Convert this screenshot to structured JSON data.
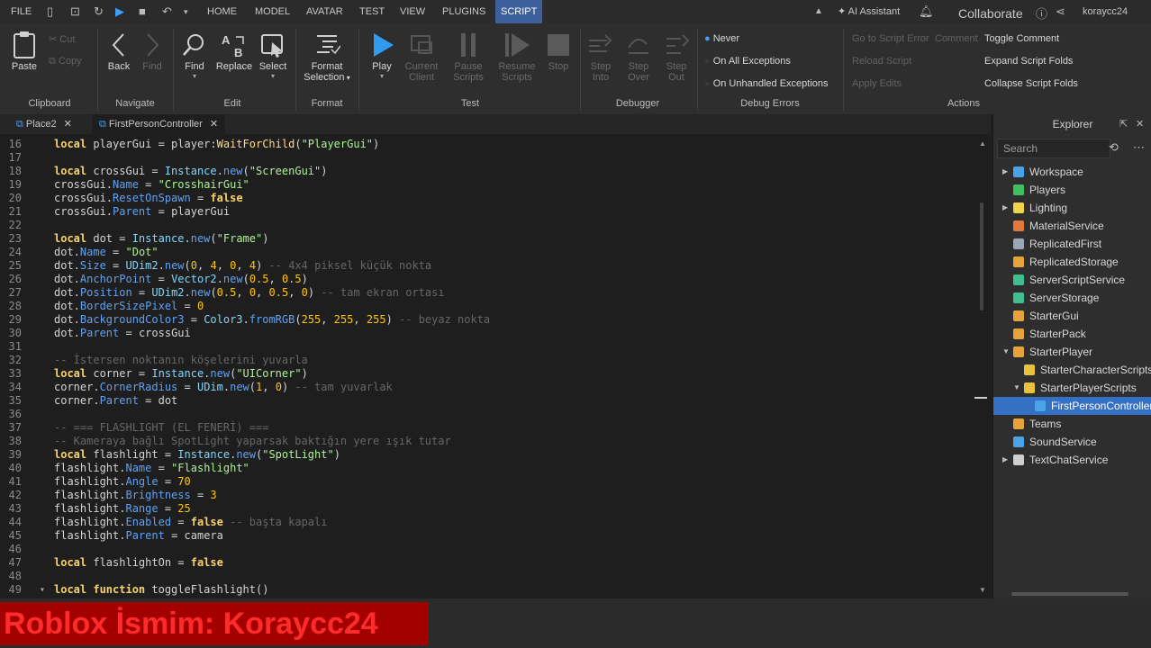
{
  "menubar": {
    "file": "FILE",
    "tabs": [
      "HOME",
      "MODEL",
      "AVATAR",
      "TEST",
      "VIEW",
      "PLUGINS",
      "SCRIPT"
    ],
    "active_tab": "SCRIPT",
    "ai_assistant": "AI Assistant",
    "collaborate": "Collaborate",
    "username": "koraycc24"
  },
  "ribbon": {
    "clipboard": {
      "paste": "Paste",
      "cut": "Cut",
      "copy": "Copy",
      "group": "Clipboard"
    },
    "navigate": {
      "back": "Back",
      "find": "Find",
      "group": "Navigate"
    },
    "edit": {
      "find": "Find",
      "replace": "Replace",
      "select": "Select",
      "group": "Edit"
    },
    "format": {
      "format_selection_1": "Format",
      "format_selection_2": "Selection",
      "group": "Format"
    },
    "test": {
      "play": "Play",
      "current_1": "Current",
      "current_2": "Client",
      "pause_1": "Pause",
      "pause_2": "Scripts",
      "resume_1": "Resume",
      "resume_2": "Scripts",
      "stop": "Stop",
      "group": "Test"
    },
    "debugger": {
      "step_into_1": "Step",
      "step_into_2": "Into",
      "step_over_1": "Step",
      "step_over_2": "Over",
      "step_out_1": "Step",
      "step_out_2": "Out",
      "group": "Debugger"
    },
    "debug_errors": {
      "never": "Never",
      "all": "On All Exceptions",
      "unhandled": "On Unhandled Exceptions",
      "group": "Debug Errors"
    },
    "actions": {
      "goto_error": "Go to Script Error",
      "comment": "Comment",
      "reload": "Reload Script",
      "apply": "Apply Edits",
      "toggle_comment": "Toggle Comment",
      "expand": "Expand Script Folds",
      "collapse": "Collapse Script Folds",
      "group": "Actions"
    }
  },
  "tabs": [
    "Place2",
    "FirstPersonController"
  ],
  "code": [
    {
      "n": "16",
      "t": "local playerGui = player:WaitForChild(\"PlayerGui\")"
    },
    {
      "n": "17",
      "t": ""
    },
    {
      "n": "18",
      "t": "local crossGui = Instance.new(\"ScreenGui\")"
    },
    {
      "n": "19",
      "t": "crossGui.Name = \"CrosshairGui\""
    },
    {
      "n": "20",
      "t": "crossGui.ResetOnSpawn = false"
    },
    {
      "n": "21",
      "t": "crossGui.Parent = playerGui"
    },
    {
      "n": "22",
      "t": ""
    },
    {
      "n": "23",
      "t": "local dot = Instance.new(\"Frame\")"
    },
    {
      "n": "24",
      "t": "dot.Name = \"Dot\""
    },
    {
      "n": "25",
      "t": "dot.Size = UDim2.new(0, 4, 0, 4) -- 4x4 piksel küçük nokta"
    },
    {
      "n": "26",
      "t": "dot.AnchorPoint = Vector2.new(0.5, 0.5)"
    },
    {
      "n": "27",
      "t": "dot.Position = UDim2.new(0.5, 0, 0.5, 0) -- tam ekran ortası"
    },
    {
      "n": "28",
      "t": "dot.BorderSizePixel = 0"
    },
    {
      "n": "29",
      "t": "dot.BackgroundColor3 = Color3.fromRGB(255, 255, 255) -- beyaz nokta"
    },
    {
      "n": "30",
      "t": "dot.Parent = crossGui"
    },
    {
      "n": "31",
      "t": ""
    },
    {
      "n": "32",
      "t": "-- İstersen noktanın köşelerini yuvarla"
    },
    {
      "n": "33",
      "t": "local corner = Instance.new(\"UICorner\")"
    },
    {
      "n": "34",
      "t": "corner.CornerRadius = UDim.new(1, 0) -- tam yuvarlak"
    },
    {
      "n": "35",
      "t": "corner.Parent = dot"
    },
    {
      "n": "36",
      "t": ""
    },
    {
      "n": "37",
      "t": "-- === FLASHLIGHT (EL FENERİ) ==="
    },
    {
      "n": "38",
      "t": "-- Kameraya bağlı SpotLight yaparsak baktığın yere ışık tutar"
    },
    {
      "n": "39",
      "t": "local flashlight = Instance.new(\"SpotLight\")"
    },
    {
      "n": "40",
      "t": "flashlight.Name = \"Flashlight\""
    },
    {
      "n": "41",
      "t": "flashlight.Angle = 70"
    },
    {
      "n": "42",
      "t": "flashlight.Brightness = 3"
    },
    {
      "n": "43",
      "t": "flashlight.Range = 25"
    },
    {
      "n": "44",
      "t": "flashlight.Enabled = false -- başta kapalı"
    },
    {
      "n": "45",
      "t": "flashlight.Parent = camera"
    },
    {
      "n": "46",
      "t": ""
    },
    {
      "n": "47",
      "t": "local flashlightOn = false"
    },
    {
      "n": "48",
      "t": ""
    },
    {
      "n": "49",
      "t": "local function toggleFlashlight()"
    }
  ],
  "explorer": {
    "title": "Explorer",
    "search_placeholder": "Search",
    "items": [
      {
        "label": "Workspace",
        "color": "#4aa3e8"
      },
      {
        "label": "Players",
        "color": "#3fbf5f"
      },
      {
        "label": "Lighting",
        "color": "#f2d24a"
      },
      {
        "label": "MaterialService",
        "color": "#e07a3a"
      },
      {
        "label": "ReplicatedFirst",
        "color": "#9aa7b7"
      },
      {
        "label": "ReplicatedStorage",
        "color": "#e8a23a"
      },
      {
        "label": "ServerScriptService",
        "color": "#3fbf8f"
      },
      {
        "label": "ServerStorage",
        "color": "#3fbf8f"
      },
      {
        "label": "StarterGui",
        "color": "#e8a23a"
      },
      {
        "label": "StarterPack",
        "color": "#e8a23a"
      },
      {
        "label": "StarterPlayer",
        "color": "#e8a23a"
      },
      {
        "label": "StarterCharacterScripts",
        "color": "#e8c23a"
      },
      {
        "label": "StarterPlayerScripts",
        "color": "#e8c23a"
      },
      {
        "label": "FirstPersonController",
        "color": "#4aa3e8"
      },
      {
        "label": "Teams",
        "color": "#e8a23a"
      },
      {
        "label": "SoundService",
        "color": "#4aa3e8"
      },
      {
        "label": "TextChatService",
        "color": "#cfcfcf"
      }
    ]
  },
  "caption": "Roblox İsmim: Koraycc24"
}
